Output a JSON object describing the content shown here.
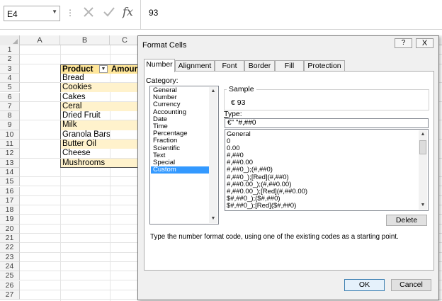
{
  "formula_bar": {
    "name_box": "E4",
    "fx_label": "fx",
    "formula_value": "93"
  },
  "sheet": {
    "columns": [
      "A",
      "B",
      "C"
    ],
    "rows": [
      "1",
      "2",
      "3",
      "4",
      "5",
      "6",
      "7",
      "8",
      "9",
      "10",
      "11",
      "12",
      "13",
      "14",
      "15",
      "16",
      "17",
      "18",
      "19",
      "20",
      "21",
      "22",
      "23",
      "24",
      "25",
      "26",
      "27"
    ],
    "table": {
      "header_product": "Product",
      "header_amount": "Amour",
      "products": [
        "Bread",
        "Cookies",
        "Cakes",
        "Ceral",
        "Dried Fruit",
        "Milk",
        "Granola Bars",
        "Butter Oil",
        "Cheese",
        "Mushrooms"
      ]
    },
    "colors": {
      "header_fill": "#ffe699",
      "band_fill": "#fff2cc"
    }
  },
  "dialog": {
    "title": "Format Cells",
    "help_glyph": "?",
    "close_glyph": "X",
    "tabs": [
      "Number",
      "Alignment",
      "Font",
      "Border",
      "Fill",
      "Protection"
    ],
    "active_tab": "Number",
    "category_label": "Category:",
    "categories": [
      "General",
      "Number",
      "Currency",
      "Accounting",
      "Date",
      "Time",
      "Percentage",
      "Fraction",
      "Scientific",
      "Text",
      "Special",
      "Custom"
    ],
    "selected_category": "Custom",
    "sample_label": "Sample",
    "sample_value": "€ 93",
    "type_label": "Type:",
    "type_value": "€\" \"#,##0",
    "formats": [
      "General",
      "0",
      "0.00",
      "#,##0",
      "#,##0.00",
      "#,##0_);(#,##0)",
      "#,##0_);[Red](#,##0)",
      "#,##0.00_);(#,##0.00)",
      "#,##0.00_);[Red](#,##0.00)",
      "$#,##0_);($#,##0)",
      "$#,##0_);[Red]($#,##0)"
    ],
    "delete_label": "Delete",
    "hint": "Type the number format code, using one of the existing codes as a starting point.",
    "ok_label": "OK",
    "cancel_label": "Cancel"
  }
}
